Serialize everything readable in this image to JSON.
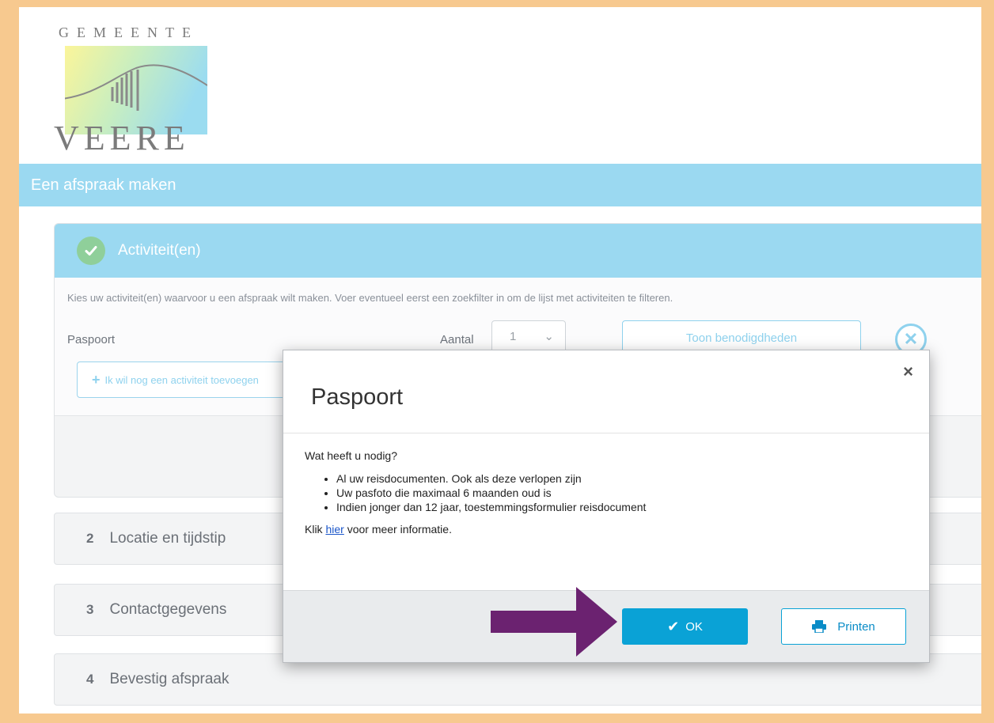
{
  "logo": {
    "top_text": "GEMEENTE",
    "bottom_text": "VEERE"
  },
  "topbar": {
    "title": "Een afspraak maken"
  },
  "step1": {
    "title": "Activiteit(en)",
    "hint": "Kies uw activiteit(en) waarvoor u een afspraak wilt maken. Voer eventueel eerst een zoekfilter in om de lijst met activiteiten te filteren.",
    "activity": "Paspoort",
    "aantal_label": "Aantal",
    "aantal_value": "1",
    "toon_button": "Toon benodigdheden",
    "add_button": "Ik wil nog een activiteit toevoegen"
  },
  "steps": [
    {
      "num": "2",
      "label": "Locatie en tijdstip"
    },
    {
      "num": "3",
      "label": "Contactgegevens"
    },
    {
      "num": "4",
      "label": "Bevestig afspraak"
    }
  ],
  "modal": {
    "title": "Paspoort",
    "close": "×",
    "question": "Wat heeft u nodig?",
    "items": [
      "Al uw reisdocumenten. Ook als deze verlopen zijn",
      "Uw pasfoto die maximaal 6 maanden oud is",
      "Indien jonger dan 12 jaar, toestemmingsformulier reisdocument"
    ],
    "info_prefix": "Klik",
    "info_link": "hier",
    "info_suffix": "voor meer informatie.",
    "ok_button": "OK",
    "print_button": "Printen"
  },
  "colors": {
    "accent": "#9bd9f1",
    "primary_button": "#0aa2d6",
    "success": "#8fcf9a",
    "arrow": "#6b2270",
    "page_border": "#f7c98f"
  }
}
